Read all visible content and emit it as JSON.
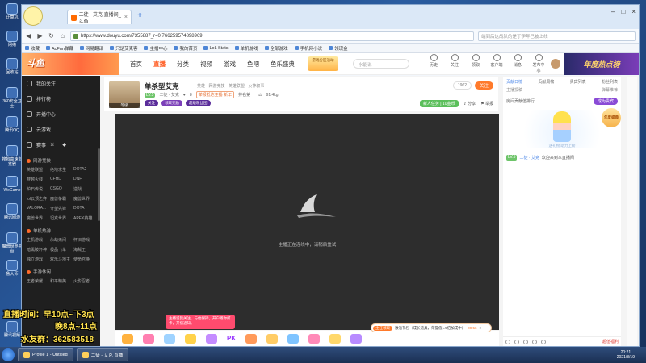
{
  "desktop": {
    "icons": [
      "计算机",
      "网络",
      "回收站",
      "360安全卫士",
      "腾讯QQ",
      "搜狗高速浏览器",
      "WeGame",
      "腾讯网游",
      "魔兽世界平台",
      "鲁大师",
      "腾讯视频"
    ],
    "overlay": {
      "line1": "直播时间：早10点~下3点",
      "line2": "晚8点~11点",
      "line3": "水友群：362583518"
    }
  },
  "browser": {
    "tab_title": "二徒 - 艾克 直播间_斗鱼",
    "url": "https://www.douyu.com/7355887_r=0.766259574898969",
    "search_placeholder": "端到后这战队的是丁伊年已被上线",
    "bookmarks": [
      "收藏",
      "AcFun弹幕",
      "网易翻译",
      "只是艾克客",
      "主播中心",
      "我的首页",
      "LoL Stats",
      "单机游戏",
      "全部游戏",
      "手机网小说",
      "领现金"
    ]
  },
  "douyu_header": {
    "logo": "斗鱼",
    "nav": [
      "首页",
      "直播",
      "分类",
      "视频",
      "游戏",
      "鱼吧",
      "鱼乐盛典"
    ],
    "promo": "游戏分区活动",
    "search_placeholder": "水能说",
    "actions": [
      "历史",
      "关注",
      "领取",
      "客户端",
      "消息",
      "发布中心"
    ],
    "right_banner": "年度热点榜"
  },
  "sidebar": {
    "top_items": [
      "我的关注",
      "排行榜",
      "开播中心",
      "云游戏",
      "赛事"
    ],
    "section1_title": "网游竞技",
    "section1_games": [
      "英雄联盟",
      "绝地求生",
      "DOTA2",
      "穿越火线",
      "CFHD",
      "DNF",
      "炉石传说",
      "CSGO",
      "逆战",
      "lol云顶之弈",
      "魔兽争霸",
      "魔兽世界",
      "VALORA...",
      "守望先锋",
      "DOTA",
      "魔兽世界",
      "坦克世界",
      "APEX英雄"
    ],
    "section2_title": "单机热游",
    "section2_games": [
      "主机游戏",
      "永劫无间",
      "怀旧游戏",
      "暗黑破坏神",
      "极品飞车",
      "海贼王",
      "独立游戏",
      "欢乐斗地主",
      "使命召唤"
    ],
    "section3_title": "手游休闲",
    "section3_games": [
      "王者荣耀",
      "和平精英",
      "火影忍者"
    ]
  },
  "room": {
    "avatar_level": "等级",
    "title": "单杀型艾克",
    "category": "英雄 · 网游竞技 · 英雄联盟 · 火神叙事",
    "level_badge": "LV.5",
    "streamer": "二徒 · 艾克",
    "fans": "8",
    "report_badge": "举报抵达主播 新年",
    "rank": "排名第一",
    "weight": "91.4kg",
    "tags": [
      "关注",
      "领取奖励",
      "超级粉丝团"
    ],
    "viewers": "1962",
    "follow_label": "关注",
    "newbie_label": "新人任务 | 10金币",
    "share": "分享",
    "report": "举报",
    "loading_text": "主播正在连线中，请稍后重试"
  },
  "toasts": {
    "left": "主播说我关注，与他保持，开户邀你打卡，开播通知。",
    "right_tag": "主任领取",
    "right_text": "激活礼包（成长道具，荣誉值1.5倍加成中）",
    "right_time": "09:56"
  },
  "chat": {
    "tabs": [
      "贡献日榜",
      "贡献周榜",
      "贵宾列表",
      "粉丝列表"
    ],
    "subtabs": [
      "主播投稿",
      "弹幕推荐"
    ],
    "rank_label": "房间贡献值排行",
    "rank_btn": "成为贵宾",
    "art_caption": "送礼物 助力上榜",
    "msg_level": "LV.5",
    "msg_user": "二徒 · 艾克",
    "msg_text": "欢迎来到本直播间",
    "bottom_red": "超值福利",
    "float_badge": "年度盛典"
  },
  "taskbar": {
    "tasks": [
      "Profile 1 - Untitled",
      "二徒 - 艾克 直播"
    ],
    "time": "20:21",
    "date": "2021/8/19"
  },
  "colors": {
    "douyu_orange": "#ff7a2b",
    "sidebar_bg": "#1f1f1f",
    "player_bg": "#2d2d2d",
    "overlay_yellow": "#ffe14d"
  }
}
